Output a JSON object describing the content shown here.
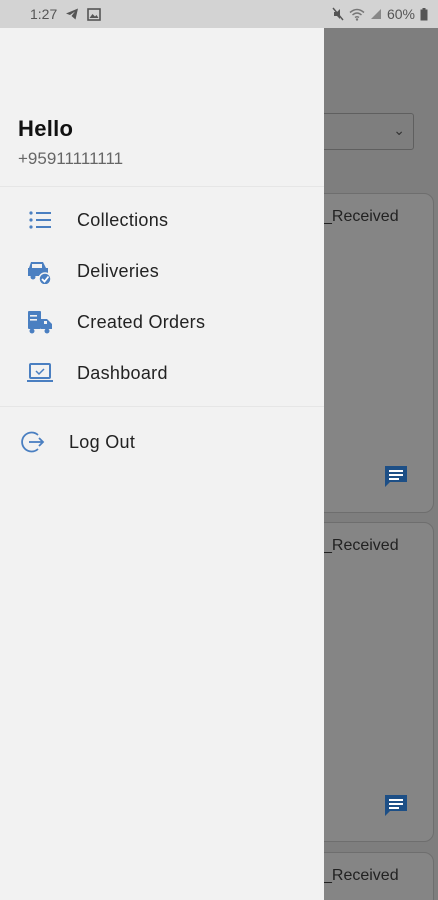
{
  "status_bar": {
    "time": "1:27",
    "battery": "60%",
    "left_icons": [
      "telegram-icon",
      "image-icon"
    ],
    "right_icons": [
      "mute-icon",
      "wifi-icon",
      "signal-icon",
      "battery-icon"
    ]
  },
  "drawer": {
    "greeting": "Hello",
    "phone": "+95911111111",
    "menu": [
      {
        "label": "Collections",
        "icon": "list-icon"
      },
      {
        "label": "Deliveries",
        "icon": "delivery-car-icon"
      },
      {
        "label": "Created Orders",
        "icon": "truck-icon"
      },
      {
        "label": "Dashboard",
        "icon": "laptop-icon"
      }
    ],
    "logout": {
      "label": "Log Out",
      "icon": "logout-icon"
    }
  },
  "background": {
    "cards": [
      {
        "status": "_Received"
      },
      {
        "status": "_Received"
      },
      {
        "status": "_Received"
      }
    ]
  },
  "colors": {
    "accent": "#4a7fc1",
    "drawer_bg": "#f2f2f2",
    "scrim": "#7e7e7e"
  }
}
